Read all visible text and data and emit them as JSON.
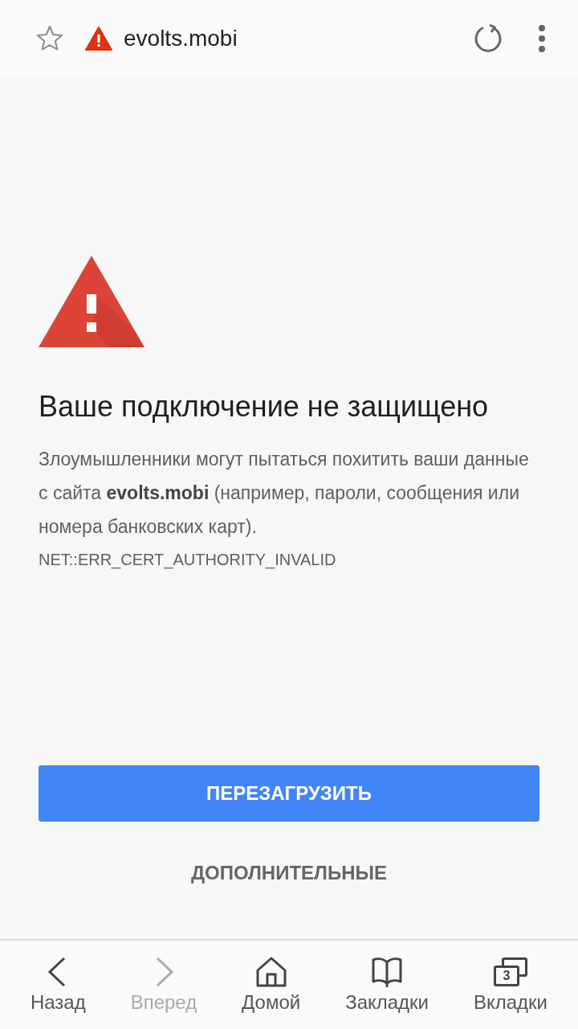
{
  "toolbar": {
    "url": "evolts.mobi"
  },
  "error": {
    "title": "Ваше подключение не защищено",
    "message": "Злоумышленники могут пытаться похитить ваши данные с сайта **evolts.mobi** (например, пароли, сообщения или номера банковских карт).",
    "code": "NET::ERR_CERT_AUTHORITY_INVALID"
  },
  "buttons": {
    "primary": "ПЕРЕЗАГРУЗИТЬ",
    "secondary": "ДОПОЛНИТЕЛЬНЫЕ"
  },
  "nav": [
    {
      "kind": "back",
      "label": "Назад",
      "disabled": false
    },
    {
      "kind": "forward",
      "label": "Вперед",
      "disabled": true
    },
    {
      "kind": "home",
      "label": "Домой",
      "disabled": false
    },
    {
      "kind": "bookmarks",
      "label": "Закладки",
      "disabled": false
    },
    {
      "kind": "tabs",
      "label": "Вкладки",
      "disabled": false,
      "count": "3"
    }
  ]
}
